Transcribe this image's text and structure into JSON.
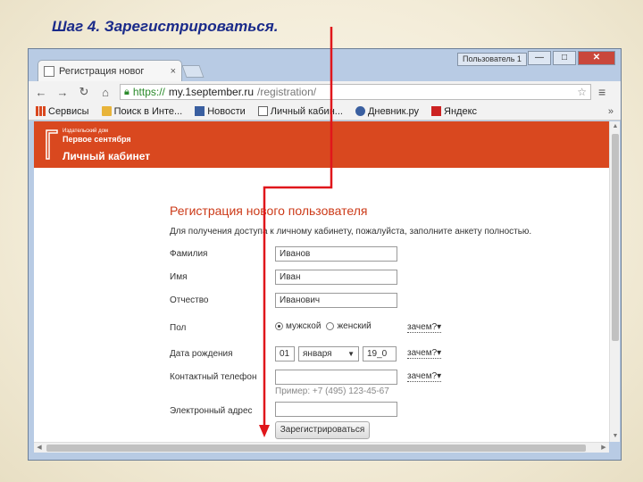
{
  "slide": {
    "title": "Шаг 4.  Зарегистрироваться."
  },
  "browser": {
    "tab_title": "Регистрация новог",
    "tab_close": "×",
    "profile": "Пользователь 1",
    "win_min": "—",
    "win_max": "□",
    "win_close": "✕",
    "url": {
      "scheme": "https://",
      "host": "my.1september.ru",
      "path": "/registration/"
    }
  },
  "bookmarks": [
    {
      "label": "Сервисы",
      "icon": "apps-grid-icon",
      "color": "#d9481f"
    },
    {
      "label": "Поиск в Инте...",
      "icon": "folder-icon",
      "color": "#e8b43a"
    },
    {
      "label": "Новости",
      "icon": "news-icon",
      "color": "#3a5fa0"
    },
    {
      "label": "Личный кабин...",
      "icon": "page-icon",
      "color": "#666666"
    },
    {
      "label": "Дневник.ру",
      "icon": "diary-icon",
      "color": "#3a5fa0"
    },
    {
      "label": "Яндекс",
      "icon": "yandex-icon",
      "color": "#cc2222"
    }
  ],
  "site": {
    "logo_small": "Издательский дом",
    "logo_name": "Первое сентября",
    "cabinet": "Личный кабинет",
    "accent": "#d9481f"
  },
  "form": {
    "title": "Регистрация нового пользователя",
    "description": "Для получения доступа к личному кабинету, пожалуйста, заполните анкету полностью.",
    "surname_label": "Фамилия",
    "surname_value": "Иванов",
    "name_label": "Имя",
    "name_value": "Иван",
    "patronymic_label": "Отчество",
    "patronymic_value": "Иванович",
    "gender_label": "Пол",
    "gender_male": "мужской",
    "gender_female": "женский",
    "why": "зачем?▾",
    "birth_label": "Дата рождения",
    "birth_day": "01",
    "birth_month": "января",
    "birth_year": "19_0",
    "phone_label": "Контактный телефон",
    "phone_hint": "Пример: +7 (495) 123-45-67",
    "email_label": "Электронный адрес",
    "submit": "Зарегистрироваться"
  }
}
